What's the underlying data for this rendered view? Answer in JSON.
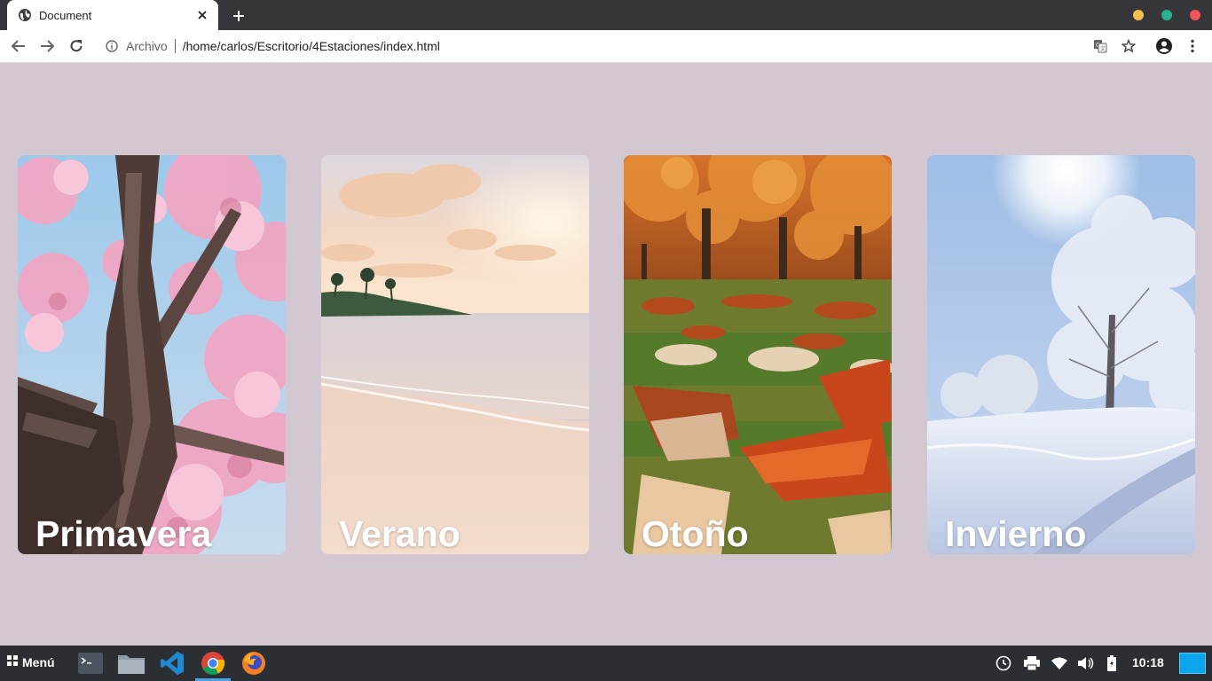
{
  "browser": {
    "tab": {
      "title": "Document",
      "favicon": "globe-icon",
      "close_icon": "close-icon"
    },
    "new_tab_icon": "plus-icon",
    "window_controls": [
      {
        "name": "minimize",
        "color": "#f4bf4f"
      },
      {
        "name": "maximize",
        "color": "#28b090"
      },
      {
        "name": "close",
        "color": "#f0555a"
      }
    ],
    "toolbar": {
      "back_icon": "arrow-left-icon",
      "forward_icon": "arrow-right-icon",
      "reload_icon": "reload-icon",
      "site_info_icon": "info-icon",
      "scheme": "Archivo",
      "url": "/home/carlos/Escritorio/4Estaciones/index.html",
      "translate_icon": "translate-icon",
      "bookmark_icon": "star-icon",
      "profile_icon": "account-icon",
      "menu_icon": "kebab-menu-icon"
    }
  },
  "page": {
    "background": "#d3c8d2",
    "cards": [
      {
        "label": "Primavera"
      },
      {
        "label": "Verano"
      },
      {
        "label": "Otoño"
      },
      {
        "label": "Invierno"
      }
    ]
  },
  "taskbar": {
    "menu_label": "Menú",
    "menu_icon": "grid-icon",
    "apps": [
      {
        "name": "terminal",
        "icon": "terminal-icon"
      },
      {
        "name": "files",
        "icon": "folder-icon"
      },
      {
        "name": "vscode",
        "icon": "vscode-icon"
      },
      {
        "name": "chrome",
        "icon": "chrome-icon",
        "active": true
      },
      {
        "name": "firefox",
        "icon": "firefox-icon"
      }
    ],
    "tray": [
      "clock-alarm-icon",
      "printer-icon",
      "wifi-icon",
      "volume-icon",
      "battery-icon"
    ],
    "time": "10:18"
  }
}
